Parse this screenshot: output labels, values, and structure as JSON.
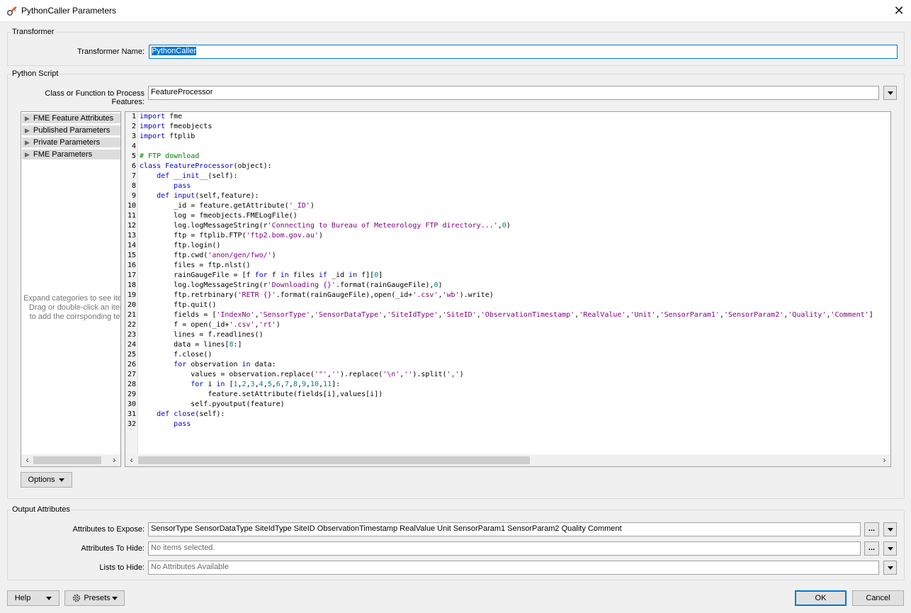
{
  "window": {
    "title": "PythonCaller Parameters",
    "close_glyph": "✕"
  },
  "transformer": {
    "group_label": "Transformer",
    "name_label": "Transformer Name:",
    "name_value": "PythonCaller"
  },
  "python_script": {
    "group_label": "Python Script",
    "class_label": "Class or Function to Process Features:",
    "class_value": "FeatureProcessor",
    "tree": {
      "items": [
        "FME Feature Attributes",
        "Published Parameters",
        "Private Parameters",
        "FME Parameters"
      ],
      "hint": "Expand categories to see iten\nDrag or double-click an item\nto add the corrsponding text"
    },
    "code": [
      "import fme",
      "import fmeobjects",
      "import ftplib",
      "",
      "# FTP download",
      "class FeatureProcessor(object):",
      "    def __init__(self):",
      "        pass",
      "    def input(self,feature):",
      "        _id = feature.getAttribute('_ID')",
      "        log = fmeobjects.FMELogFile()",
      "        log.logMessageString(r'Connecting to Bureau of Meteorology FTP directory...',0)",
      "        ftp = ftplib.FTP('ftp2.bom.gov.au')",
      "        ftp.login()",
      "        ftp.cwd('anon/gen/fwo/')",
      "        files = ftp.nlst()",
      "        rainGaugeFile = [f for f in files if _id in f][0]",
      "        log.logMessageString(r'Downloading {}'.format(rainGaugeFile),0)",
      "        ftp.retrbinary('RETR {}'.format(rainGaugeFile),open(_id+'.csv','wb').write)",
      "        ftp.quit()",
      "        fields = ['IndexNo','SensorType','SensorDataType','SiteIdType','SiteID','ObservationTimestamp','RealValue','Unit','SensorParam1','SensorParam2','Quality','Comment']",
      "        f = open(_id+'.csv','rt')",
      "        lines = f.readlines()",
      "        data = lines[8:]",
      "        f.close()",
      "        for observation in data:",
      "            values = observation.replace('\"','').replace('\\n','').split(',')",
      "            for i in [1,2,3,4,5,6,7,8,9,10,11]:",
      "                feature.setAttribute(fields[i],values[i])",
      "            self.pyoutput(feature)",
      "    def close(self):",
      "        pass"
    ],
    "options_label": "Options"
  },
  "output": {
    "group_label": "Output Attributes",
    "expose_label": "Attributes to Expose:",
    "expose_value": "SensorType SensorDataType SiteIdType SiteID ObservationTimestamp RealValue Unit SensorParam1 SensorParam2 Quality Comment",
    "hide_label": "Attributes To Hide:",
    "hide_placeholder": "No items selected.",
    "lists_label": "Lists to Hide:",
    "lists_placeholder": "No Attributes Available",
    "ellipsis": "..."
  },
  "footer": {
    "help": "Help",
    "presets": "Presets",
    "ok": "OK",
    "cancel": "Cancel"
  }
}
